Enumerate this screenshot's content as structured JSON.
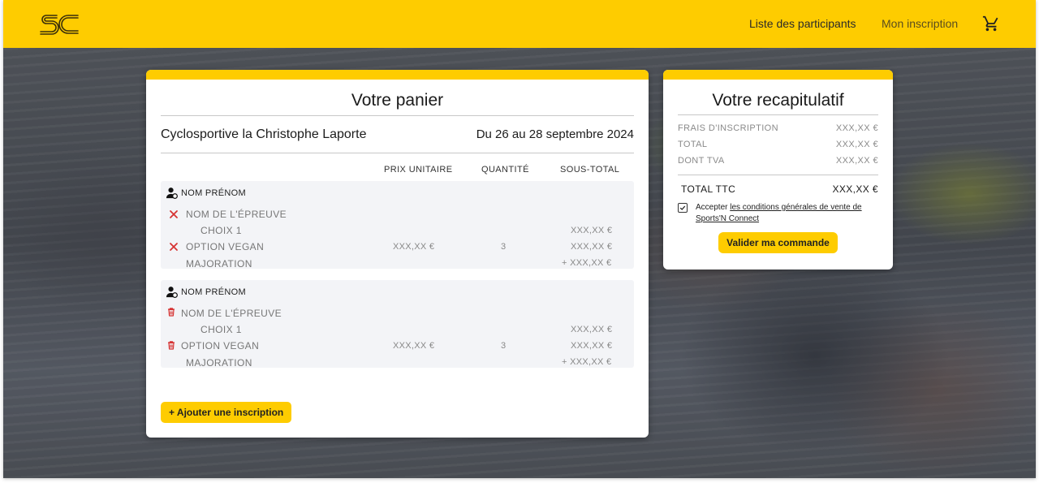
{
  "header": {
    "logo_text": "SC",
    "nav": [
      {
        "label": "Liste des participants"
      },
      {
        "label": "Mon inscription"
      }
    ],
    "cart_icon": "shopping-cart-icon"
  },
  "colors": {
    "accent": "#fecc00",
    "remove": "#d63333"
  },
  "cart": {
    "title": "Votre panier",
    "event_name": "Cyclosportive la Christophe Laporte",
    "event_date": "Du 26 au 28 septembre 2024",
    "columns": {
      "unit_price": "PRIX UNITAIRE",
      "quantity": "QUANTITÉ",
      "subtotal": "SOUS-TOTAL"
    },
    "registrations": [
      {
        "person": "NOM PRÉNOM",
        "action_icon": "close-icon",
        "event_label": "NOM DE L'ÉPREUVE",
        "choice": "CHOIX 1",
        "option": "OPTION VEGAN",
        "surcharge": "MAJORATION",
        "unit_price": "XXX,XX €",
        "quantity": "3",
        "subtotal_choice": "XXX,XX €",
        "subtotal_option": "XXX,XX €",
        "subtotal_surcharge": "+ XXX,XX €"
      },
      {
        "person": "NOM PRÉNOM",
        "action_icon": "trash-icon",
        "event_label": "NOM DE L'ÉPREUVE",
        "choice": "CHOIX 1",
        "option": "OPTION VEGAN",
        "surcharge": "MAJORATION",
        "unit_price": "XXX,XX €",
        "quantity": "3",
        "subtotal_choice": "XXX,XX €",
        "subtotal_option": "XXX,XX €",
        "subtotal_surcharge": "+ XXX,XX €"
      }
    ],
    "add_button": "+ Ajouter une inscription"
  },
  "summary": {
    "title": "Votre recapitulatif",
    "rows": [
      {
        "label": "FRAIS D'INSCRIPTION",
        "value": "XXX,XX €"
      },
      {
        "label": "TOTAL",
        "value": "XXX,XX €"
      },
      {
        "label": "DONT TVA",
        "value": "XXX,XX €"
      }
    ],
    "total_label": "TOTAL TTC",
    "total_value": "XXX,XX €",
    "terms_prefix": "Accepter",
    "terms_link": "les conditions générales de vente de Sports'N Connect",
    "terms_checked": true,
    "validate_button": "Valider ma commande"
  }
}
